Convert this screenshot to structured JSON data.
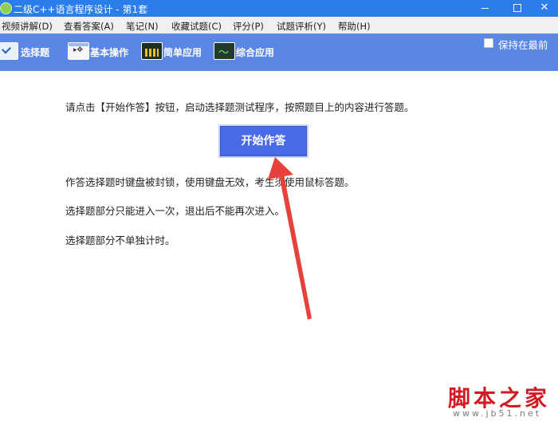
{
  "window": {
    "title": "二级C++语言程序设计 - 第1套",
    "minimize_glyph": "",
    "close_glyph": "✕"
  },
  "menu": [
    {
      "label": "视频讲解(D)"
    },
    {
      "label": "查看答案(A)"
    },
    {
      "label": "笔记(N)"
    },
    {
      "label": "收藏试题(C)"
    },
    {
      "label": "评分(P)"
    },
    {
      "label": "试题评析(Y)"
    },
    {
      "label": "帮助(H)"
    }
  ],
  "toolbar": {
    "items": [
      {
        "label": "选择题",
        "icon": "checkmark-icon"
      },
      {
        "label": "基本操作",
        "icon": "window-cursor-icon"
      },
      {
        "label": "简单应用",
        "icon": "equalizer-icon"
      },
      {
        "label": "综合应用",
        "icon": "waveform-icon"
      }
    ],
    "keep_on_top_label": "保持在最前",
    "keep_on_top_checked": false
  },
  "content": {
    "instruction": "请点击【开始作答】按钮，启动选择题测试程序，按照题目上的内容进行答题。",
    "start_button": "开始作答",
    "note1": "作答选择题时键盘被封锁，使用键盘无效，考生须使用鼠标答题。",
    "note2": "选择题部分只能进入一次，退出后不能再次进入。",
    "note3": "选择题部分不单独计时。"
  },
  "annotation": {
    "arrow_color": "#e8413c"
  },
  "watermark": {
    "text": "脚本之家",
    "url": "www.jb51.net"
  }
}
